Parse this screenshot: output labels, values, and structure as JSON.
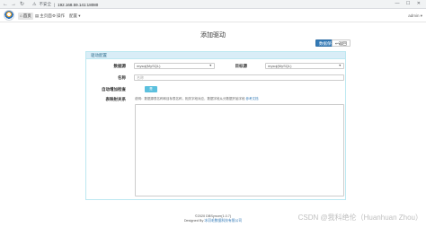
{
  "browser": {
    "back_icon": "arrow-left-icon",
    "forward_icon": "arrow-right-icon",
    "reload_icon": "reload-icon",
    "security_label": "不安全",
    "url": "192.168.59.141:18080",
    "window_controls": "— ☐ ✕"
  },
  "nav": {
    "items": [
      {
        "label": "首页",
        "icon": "home-icon",
        "active": true
      },
      {
        "label": "主页面",
        "icon": "page-icon",
        "active": false
      },
      {
        "label": "操作",
        "icon": "ops-icon",
        "active": false
      },
      {
        "label": "配置 ▾",
        "icon": "config-icon",
        "active": false
      }
    ],
    "user": "admin ▾"
  },
  "page": {
    "title": "添加驱动",
    "save_label": "数据保存",
    "back_label": "返回"
  },
  "panel": {
    "heading": "驱动配置",
    "fields": {
      "data_source_label": "数据源",
      "data_source_value": "mysql(MySQL)",
      "target_source_label": "目标源",
      "target_source_value": "mysql(MySQL)",
      "name_label": "名称",
      "name_placeholder": "名称",
      "toggle_label": "自动增加检查",
      "toggle_value": "是",
      "sql_label": "表映射关系",
      "sql_help": "说明：数据源表名称和目标表名称，相关字段对应，数据字段从分数据开始字段",
      "sql_help_link": "参考文档"
    }
  },
  "footer": {
    "line1": "©2020 DBSyncer(1.0.7)",
    "line2_prefix": "Designed By",
    "line2_link": "冰羽毛数据科技有限公司"
  },
  "watermark": "CSDN @我科绝伦（Huanhuan Zhou）"
}
